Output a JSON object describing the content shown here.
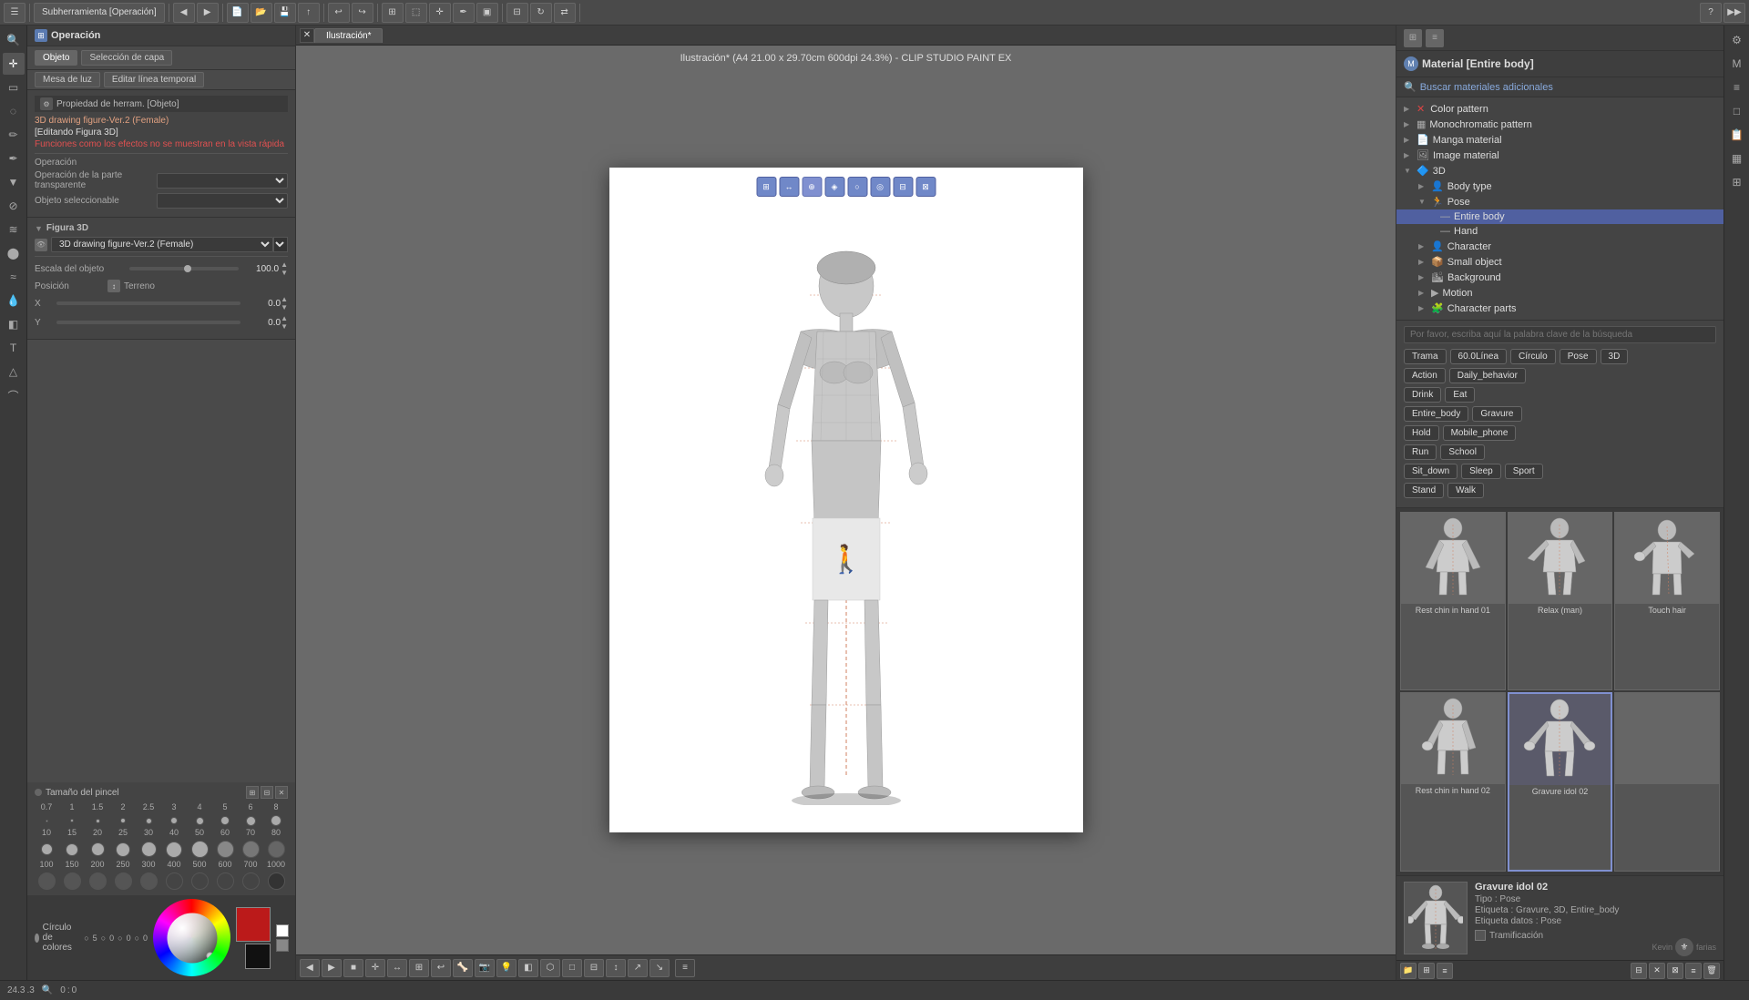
{
  "window": {
    "title": "Ilustración* (A4 21.00 x 29.70cm 600dpi 24.3%) - CLIP STUDIO PAINT EX",
    "tab": "Ilustración*"
  },
  "toolbar": {
    "subherramienta_label": "Subherramienta [Operación]"
  },
  "left_panel": {
    "operation_title": "Operación",
    "tabs": [
      "Objeto",
      "Selección de capa"
    ],
    "extra_tabs": [
      "Mesa de luz",
      "Editar línea temporal"
    ],
    "property_title": "Propiedad de herram. [Objeto]",
    "figure_name": "3D drawing figure-Ver.2 (Female)",
    "figure_edit": "[Editando Figura 3D]",
    "warning": "Funciones como los efectos no se muestran en la vista rápida",
    "operacion_label": "Operación",
    "operacion_transparente": "Operación de la parte transparente",
    "objeto_seleccionable": "Objeto seleccionable",
    "figura3d_title": "Figura 3D",
    "figura_model": "3D drawing figure-Ver.2 (Female)",
    "escala_label": "Escala del objeto",
    "escala_val": "100.0",
    "posicion_label": "Posición",
    "terreno_label": "Terreno",
    "x_label": "X",
    "y_label": "Y",
    "x_val": "0.0",
    "y_val": "0.0",
    "brush_title": "Tamaño del pincel",
    "brush_sizes": [
      "0.7",
      "1",
      "1.5",
      "2",
      "2.5",
      "3",
      "4",
      "5",
      "6",
      "8"
    ],
    "brush_sizes2": [
      "10",
      "15",
      "20",
      "25",
      "30",
      "40",
      "50",
      "60",
      "70",
      "80"
    ],
    "brush_sizes3": [
      "100",
      "150",
      "200",
      "250",
      "300",
      "400",
      "500",
      "600",
      "700",
      "1000"
    ],
    "color_title": "Círculo de colores"
  },
  "canvas": {
    "zoom": "24.3",
    "pos_x": "0.0",
    "pos_y": "0.0"
  },
  "figure_icons": [
    "↺",
    "↻",
    "⊕",
    "⊗",
    "◈",
    "◎",
    "⊞",
    "⊠"
  ],
  "material_panel": {
    "title": "Material [Entire body]",
    "search_placeholder": "Por favor, escriba aquí la palabra clave de la búsqueda",
    "find_more": "Buscar materiales adicionales",
    "tree_items": [
      {
        "label": "Color pattern",
        "level": 0,
        "icon": "×"
      },
      {
        "label": "Monochromatic pattern",
        "level": 0
      },
      {
        "label": "Manga material",
        "level": 0
      },
      {
        "label": "Image material",
        "level": 0
      },
      {
        "label": "3D",
        "level": 0,
        "expanded": true
      },
      {
        "label": "Body type",
        "level": 1
      },
      {
        "label": "Pose",
        "level": 1,
        "expanded": true
      },
      {
        "label": "Entire body",
        "level": 2,
        "selected": true
      },
      {
        "label": "Hand",
        "level": 2
      },
      {
        "label": "Character",
        "level": 1
      },
      {
        "label": "Small object",
        "level": 1
      },
      {
        "label": "Background",
        "level": 1
      },
      {
        "label": "Motion",
        "level": 1
      },
      {
        "label": "Character parts",
        "level": 1
      }
    ],
    "tags": [
      {
        "label": "Trama"
      },
      {
        "label": "60.0Línea"
      },
      {
        "label": "Círculo"
      },
      {
        "label": "Pose"
      },
      {
        "label": "3D"
      },
      {
        "label": "Action"
      },
      {
        "label": "Daily_behavior"
      },
      {
        "label": "Drink"
      },
      {
        "label": "Eat"
      },
      {
        "label": "Entire_body"
      },
      {
        "label": "Gravure"
      },
      {
        "label": "Hold"
      },
      {
        "label": "Mobile_phone"
      },
      {
        "label": "Run"
      },
      {
        "label": "School"
      },
      {
        "label": "Sit_down"
      },
      {
        "label": "Sleep"
      },
      {
        "label": "Sport"
      },
      {
        "label": "Stand"
      },
      {
        "label": "Walk"
      }
    ],
    "previews": [
      {
        "label": "Rest chin in hand 01"
      },
      {
        "label": "Relax (man)"
      },
      {
        "label": "Touch hair"
      },
      {
        "label": "Rest chin in hand 02"
      },
      {
        "label": "Gravure idol 02",
        "selected": true
      },
      {
        "label": ""
      }
    ],
    "detail": {
      "name": "Gravure idol 02",
      "type_label": "Tipo :",
      "type_val": "Pose",
      "etiqueta_label": "Etiqueta :",
      "etiqueta_val": "Gravure, 3D, Entire_body",
      "etiqueta_datos_label": "Etiqueta datos :",
      "etiqueta_datos_val": "Pose",
      "tramificacion": "Tramificación"
    }
  },
  "status_bar": {
    "zoom": "24.3",
    "pos_x": "0",
    "pos_y": "0"
  }
}
